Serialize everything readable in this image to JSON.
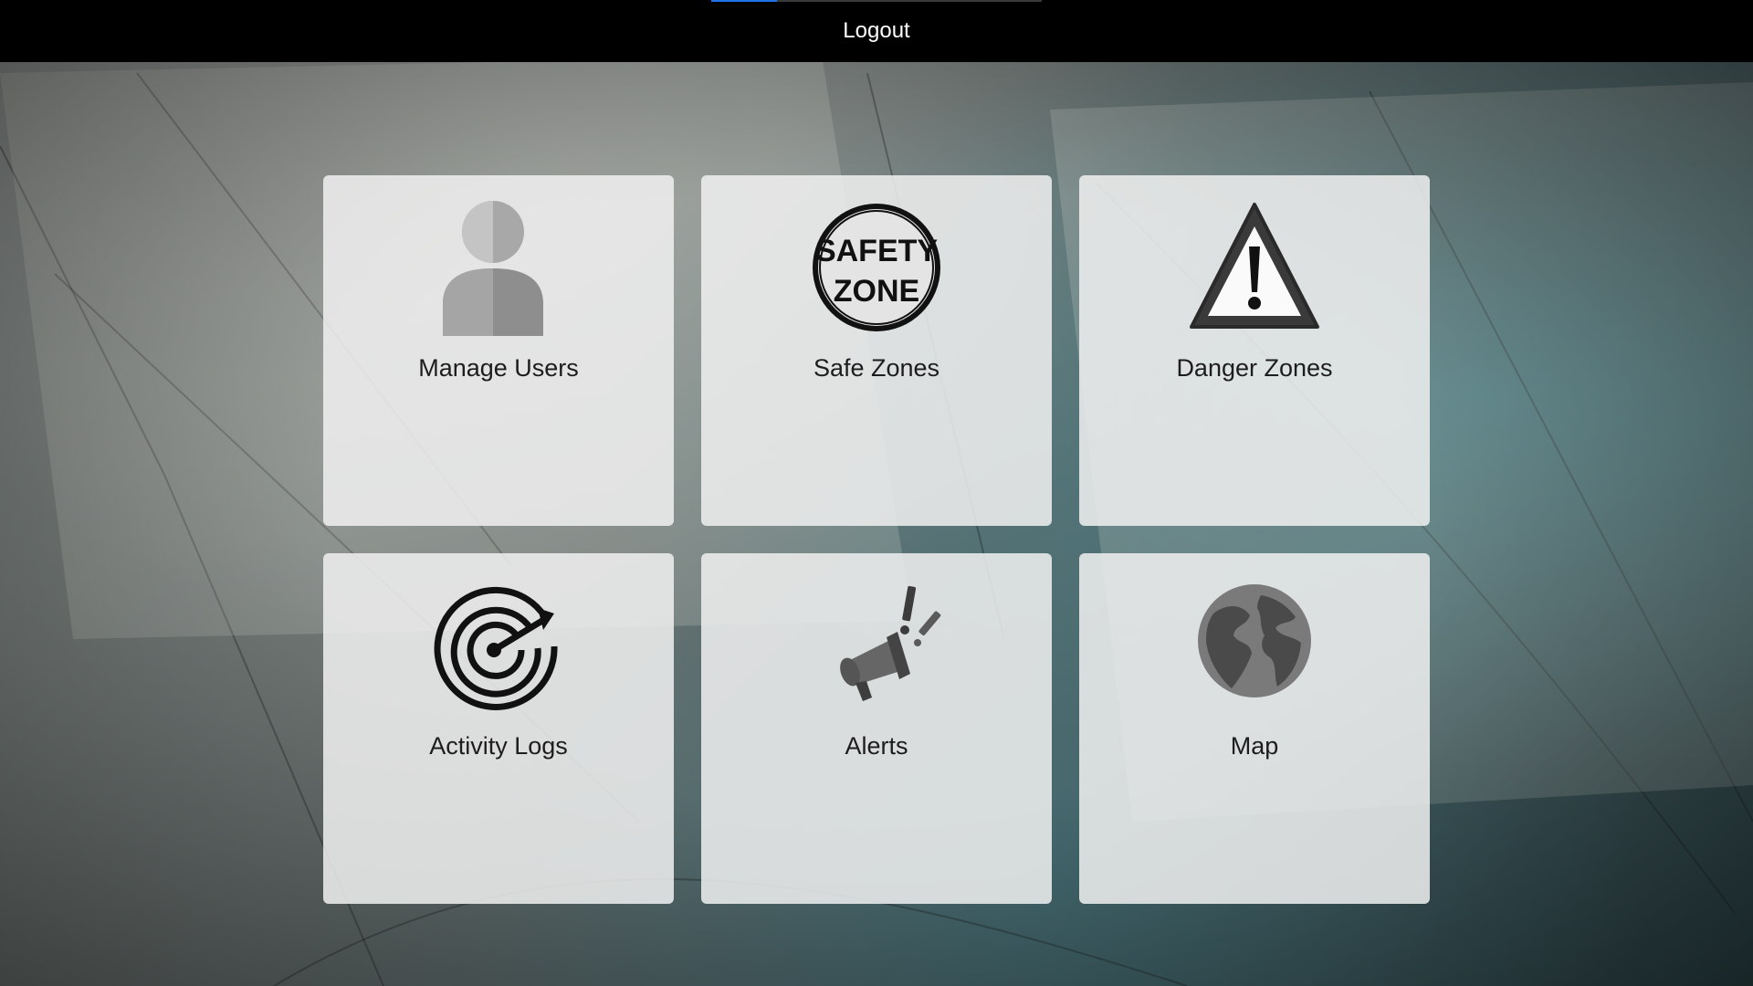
{
  "header": {
    "logout_label": "Logout",
    "progress_fraction": 0.2
  },
  "tiles": [
    {
      "label": "Manage Users",
      "icon": "user-icon"
    },
    {
      "label": "Safe Zones",
      "icon": "safety-zone-icon",
      "icon_text_line1": "SAFETY",
      "icon_text_line2": "ZONE"
    },
    {
      "label": "Danger Zones",
      "icon": "warning-icon"
    },
    {
      "label": "Activity Logs",
      "icon": "radar-icon"
    },
    {
      "label": "Alerts",
      "icon": "megaphone-alert-icon"
    },
    {
      "label": "Map",
      "icon": "globe-icon"
    }
  ],
  "colors": {
    "topbar": "#000000",
    "progress": "#1e73e8",
    "tile_bg": "#f0f0f0"
  }
}
